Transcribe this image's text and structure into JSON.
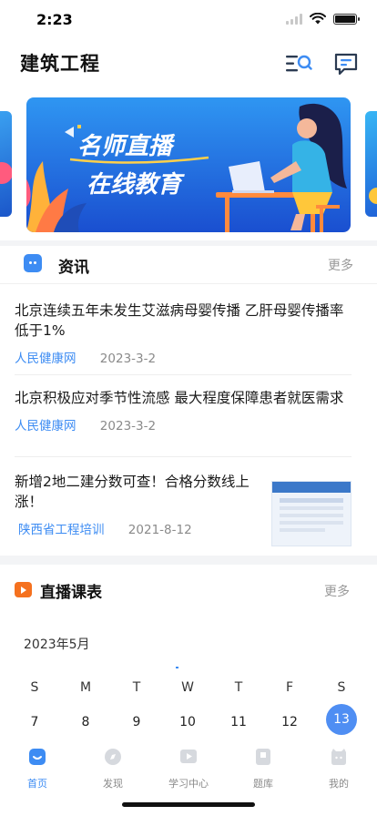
{
  "status_bar": {
    "time": "2:23"
  },
  "header": {
    "title": "建筑工程",
    "icons": [
      "list-search-icon",
      "message-icon"
    ]
  },
  "banner": {
    "text_line1": "名师直播",
    "text_line2": "在线教育",
    "colors": {
      "bg_top": "#2e8ef0",
      "bg_bottom": "#1a4fd0",
      "accent": "#ffc73a"
    }
  },
  "news": {
    "section_title": "资讯",
    "more_label": "更多",
    "items": [
      {
        "title": "北京连续五年未发生艾滋病母婴传播 乙肝母婴传播率低于1%",
        "source": "人民健康网",
        "date": "2023-3-2"
      },
      {
        "title": "北京积极应对季节性流感 最大程度保障患者就医需求",
        "source": "人民健康网",
        "date": "2023-3-2"
      },
      {
        "title": "新增2地二建分数可查！合格分数线上涨！",
        "source": "陕西省工程培训",
        "date": "2021-8-12",
        "thumbnail_icon": "webpage-screenshot-thumbnail"
      }
    ]
  },
  "live": {
    "section_title": "直播课表",
    "more_label": "更多",
    "month": "2023年5月",
    "weekdays": [
      "S",
      "M",
      "T",
      "W",
      "T",
      "F",
      "S"
    ],
    "days": [
      "7",
      "8",
      "9",
      "10",
      "11",
      "12",
      "13"
    ],
    "selected_day": "13"
  },
  "tabs": [
    {
      "label": "首页",
      "icon": "home-icon",
      "active": true
    },
    {
      "label": "发现",
      "icon": "discover-icon",
      "active": false
    },
    {
      "label": "学习中心",
      "icon": "video-play-icon",
      "active": false
    },
    {
      "label": "题库",
      "icon": "question-bank-icon",
      "active": false
    },
    {
      "label": "我的",
      "icon": "profile-icon",
      "active": false
    }
  ],
  "colors": {
    "primary": "#3d8cf3",
    "live_orange": "#f5711f",
    "muted": "#8a8a8a"
  }
}
